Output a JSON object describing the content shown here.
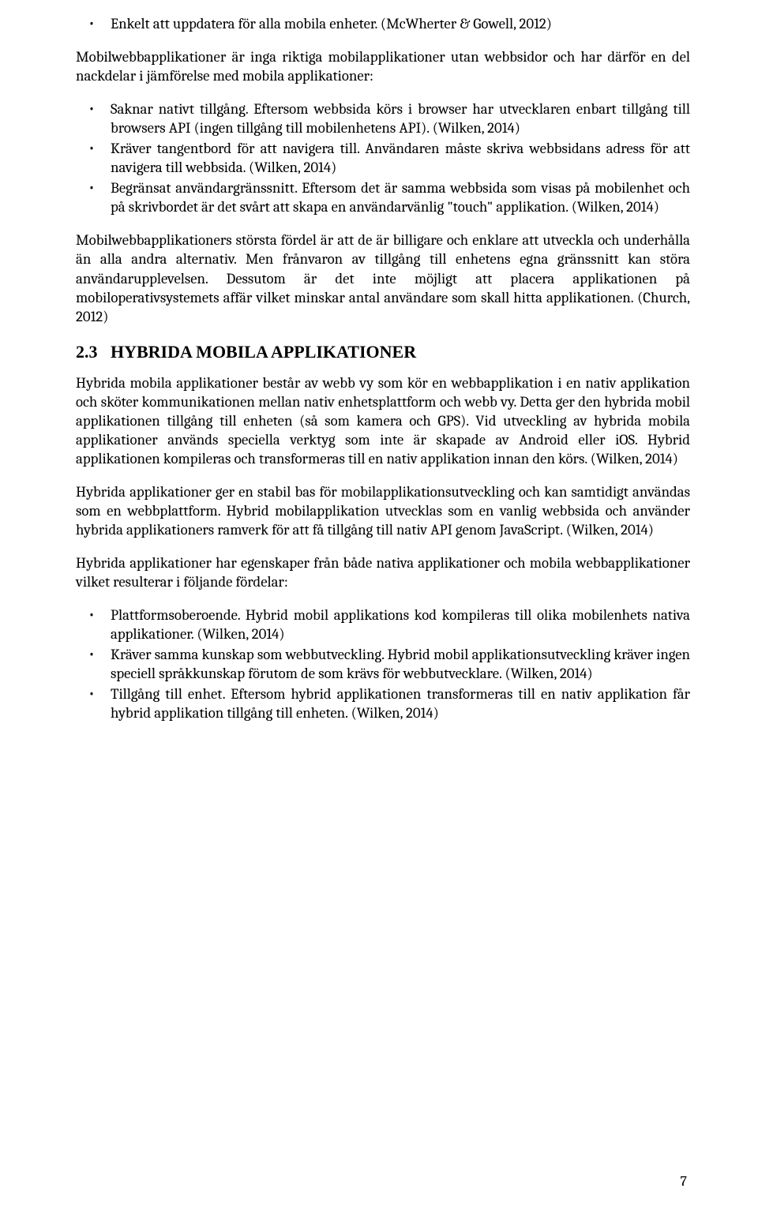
{
  "list1": {
    "item0": "Enkelt att uppdatera för alla mobila enheter. (McWherter & Gowell, 2012)"
  },
  "para1": "Mobilwebbapplikationer är inga riktiga mobilapplikationer utan webbsidor och har därför en del nackdelar i jämförelse med mobila applikationer:",
  "list2": {
    "item0": "Saknar nativt tillgång. Eftersom webbsida körs i browser har utvecklaren enbart tillgång till browsers API (ingen tillgång till mobilenhetens API). (Wilken, 2014)",
    "item1": "Kräver tangentbord för att navigera till. Användaren måste skriva webbsidans adress för att navigera till webbsida. (Wilken, 2014)",
    "item2": "Begränsat användargränssnitt. Eftersom det är samma webbsida som visas på mobilenhet och på skrivbordet är det svårt att skapa en användarvänlig \"touch\" applikation. (Wilken, 2014)"
  },
  "para2": "Mobilwebbapplikationers största fördel är att de är billigare och enklare att utveckla och underhålla än alla andra alternativ. Men frånvaron av tillgång till enhetens egna gränssnitt kan störa användarupplevelsen.  Dessutom är det inte möjligt att placera applikationen på mobiloperativsystemets affär vilket minskar antal användare som skall hitta applikationen. (Church, 2012)",
  "section": {
    "number": "2.3",
    "title": "HYBRIDA MOBILA APPLIKATIONER"
  },
  "para3": "Hybrida mobila applikationer består av webb vy som kör en webbapplikation i en nativ applikation och sköter kommunikationen mellan nativ enhetsplattform och webb vy. Detta ger den hybrida mobil applikationen tillgång till enheten (så som kamera och GPS). Vid utveckling av hybrida mobila applikationer används speciella verktyg som inte är skapade av Android eller iOS. Hybrid applikationen kompileras och transformeras till en nativ applikation innan den körs. (Wilken, 2014)",
  "para4": "Hybrida applikationer ger en stabil bas för mobilapplikationsutveckling och kan samtidigt användas som en webbplattform. Hybrid mobilapplikation utvecklas som en vanlig webbsida och använder hybrida applikationers ramverk för att få tillgång till nativ API genom JavaScript. (Wilken, 2014)",
  "para5": "Hybrida applikationer har egenskaper från både nativa applikationer och mobila webbapplikationer vilket resulterar i följande fördelar:",
  "list3": {
    "item0": "Plattformsoberoende. Hybrid mobil applikations kod kompileras till olika mobilenhets nativa applikationer. (Wilken, 2014)",
    "item1": "Kräver samma kunskap som webbutveckling. Hybrid mobil applikationsutveckling kräver ingen speciell språkkunskap förutom de som krävs för webbutvecklare. (Wilken, 2014)",
    "item2": "Tillgång till enhet. Eftersom hybrid applikationen transformeras till en nativ applikation får hybrid applikation tillgång till enheten. (Wilken, 2014)"
  },
  "pageNumber": "7"
}
